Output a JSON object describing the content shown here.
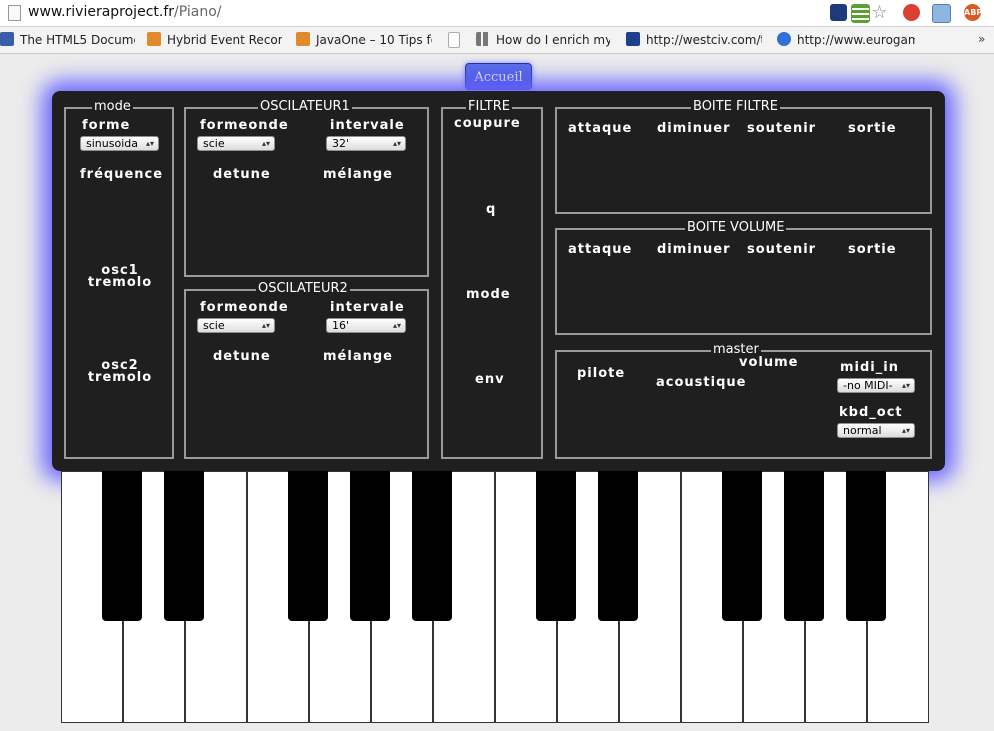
{
  "browser": {
    "url_host": "www.rivieraproject.fr",
    "url_path": "/Piano/",
    "bookmarks": [
      {
        "label": "The HTML5 Documer",
        "icon": "html5-doc-icon"
      },
      {
        "label": "Hybrid Event Recomr",
        "icon": "puzzle-icon"
      },
      {
        "label": "JavaOne – 10 Tips fo",
        "icon": "puzzle-icon"
      },
      {
        "label": "",
        "icon": "page-icon"
      },
      {
        "label": "How do I enrich my (",
        "icon": "grid-icon"
      },
      {
        "label": "http://westciv.com/t",
        "icon": "westciv-icon"
      },
      {
        "label": "http://www.eurogam",
        "icon": "globe-icon"
      }
    ]
  },
  "page": {
    "home_button": "Accueil"
  },
  "synth": {
    "mode": {
      "legend": "mode",
      "forme": "forme",
      "forme_value": "sinusoida",
      "frequence": "fréquence",
      "osc1_tremolo": [
        "osc1",
        "tremolo"
      ],
      "osc2_tremolo": [
        "osc2",
        "tremolo"
      ]
    },
    "osc1": {
      "legend": "OSCILATEUR1",
      "formeonde": "formeonde",
      "formeonde_value": "scie",
      "intervale": "intervale",
      "intervale_value": "32'",
      "detune": "detune",
      "melange": "mélange"
    },
    "osc2": {
      "legend": "OSCILATEUR2",
      "formeonde": "formeonde",
      "formeonde_value": "scie",
      "intervale": "intervale",
      "intervale_value": "16'",
      "detune": "detune",
      "melange": "mélange"
    },
    "filtre": {
      "legend": "FILTRE",
      "coupure": "coupure",
      "q": "q",
      "mode": "mode",
      "env": "env"
    },
    "boite_filtre": {
      "legend": "BOITE FILTRE",
      "attaque": "attaque",
      "diminuer": "diminuer",
      "soutenir": "soutenir",
      "sortie": "sortie"
    },
    "boite_volume": {
      "legend": "BOITE VOLUME",
      "attaque": "attaque",
      "diminuer": "diminuer",
      "soutenir": "soutenir",
      "sortie": "sortie"
    },
    "master": {
      "legend": "master",
      "pilote": "pilote",
      "volume": "volume",
      "acoustique": "acoustique",
      "midi_in": "midi_in",
      "midi_value": "-no MIDI-",
      "kbd_oct": "kbd_oct",
      "kbd_value": "normal"
    }
  },
  "colors": {
    "panel_bg": "#1f1f1f",
    "glow": "#6a66ff",
    "accent_button": "#4a5fdc"
  }
}
